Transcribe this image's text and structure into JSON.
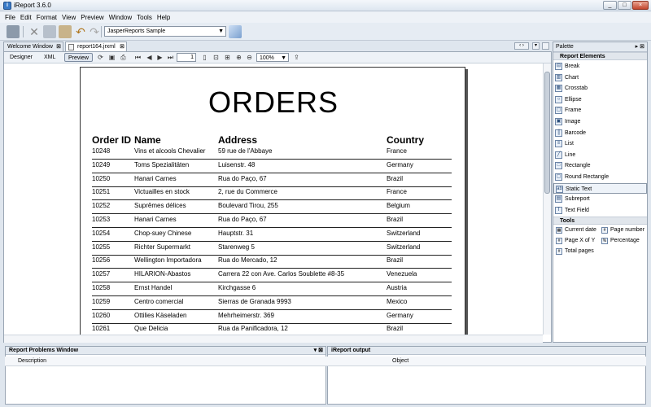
{
  "window": {
    "title": "iReport 3.6.0",
    "min": "_",
    "max": "□",
    "close": "×"
  },
  "menu": [
    "File",
    "Edit",
    "Format",
    "View",
    "Preview",
    "Window",
    "Tools",
    "Help"
  ],
  "toolbar": {
    "datasource": "JasperReports Sample"
  },
  "tabs": [
    {
      "label": "Welcome Window",
      "active": false
    },
    {
      "label": "report164.jrxml",
      "active": true
    }
  ],
  "editor": {
    "modes": [
      "Designer",
      "XML",
      "Preview"
    ],
    "selected_mode": "Preview",
    "page_number": "1",
    "zoom": "100%"
  },
  "report": {
    "title": "ORDERS",
    "columns": [
      "Order ID",
      "Name",
      "Address",
      "Country"
    ],
    "rows": [
      [
        "10248",
        "Vins et alcools Chevalier",
        "59 rue de l'Abbaye",
        "France"
      ],
      [
        "10249",
        "Toms Spezialitäten",
        "Luisenstr. 48",
        "Germany"
      ],
      [
        "10250",
        "Hanari Carnes",
        "Rua do Paço, 67",
        "Brazil"
      ],
      [
        "10251",
        "Victuailles en stock",
        "2, rue du Commerce",
        "France"
      ],
      [
        "10252",
        "Suprêmes délices",
        "Boulevard Tirou, 255",
        "Belgium"
      ],
      [
        "10253",
        "Hanari Carnes",
        "Rua do Paço, 67",
        "Brazil"
      ],
      [
        "10254",
        "Chop-suey Chinese",
        "Hauptstr. 31",
        "Switzerland"
      ],
      [
        "10255",
        "Richter Supermarkt",
        "Starenweg 5",
        "Switzerland"
      ],
      [
        "10256",
        "Wellington Importadora",
        "Rua do Mercado, 12",
        "Brazil"
      ],
      [
        "10257",
        "HILARION-Abastos",
        "Carrera 22 con Ave. Carlos Soublette #8-35",
        "Venezuela"
      ],
      [
        "10258",
        "Ernst Handel",
        "Kirchgasse 6",
        "Austria"
      ],
      [
        "10259",
        "Centro comercial",
        "Sierras de Granada 9993",
        "Mexico"
      ],
      [
        "10260",
        "Ottilies Käseladen",
        "Mehrheimerstr. 369",
        "Germany"
      ],
      [
        "10261",
        "Que Delicia",
        "Rua da Panificadora, 12",
        "Brazil"
      ]
    ]
  },
  "palette": {
    "title": "Palette",
    "sections": {
      "report_elements": "Report Elements",
      "tools": "Tools"
    },
    "elements": [
      {
        "label": "Break",
        "icon": "break-icon"
      },
      {
        "label": "Chart",
        "icon": "chart-icon"
      },
      {
        "label": "Crosstab",
        "icon": "crosstab-icon"
      },
      {
        "label": "Ellipse",
        "icon": "ellipse-icon"
      },
      {
        "label": "Frame",
        "icon": "frame-icon"
      },
      {
        "label": "Image",
        "icon": "image-icon"
      },
      {
        "label": "Barcode",
        "icon": "barcode-icon"
      },
      {
        "label": "List",
        "icon": "list-icon"
      },
      {
        "label": "Line",
        "icon": "line-icon"
      },
      {
        "label": "Rectangle",
        "icon": "rectangle-icon"
      },
      {
        "label": "Round Rectangle",
        "icon": "round-rectangle-icon"
      },
      {
        "label": "Static Text",
        "icon": "static-text-icon"
      },
      {
        "label": "Subreport",
        "icon": "subreport-icon"
      },
      {
        "label": "Text Field",
        "icon": "text-field-icon"
      }
    ],
    "tools": [
      {
        "label": "Current date",
        "icon": "calendar-icon"
      },
      {
        "label": "Page number",
        "icon": "page-number-icon"
      },
      {
        "label": "Page X of Y",
        "icon": "page-x-of-y-icon"
      },
      {
        "label": "Percentage",
        "icon": "percentage-icon"
      },
      {
        "label": "Total pages",
        "icon": "total-pages-icon"
      }
    ]
  },
  "problems": {
    "title": "Report Problems Window",
    "col_description": "Description",
    "col_object": "Object"
  },
  "output": {
    "title": "iReport output"
  }
}
